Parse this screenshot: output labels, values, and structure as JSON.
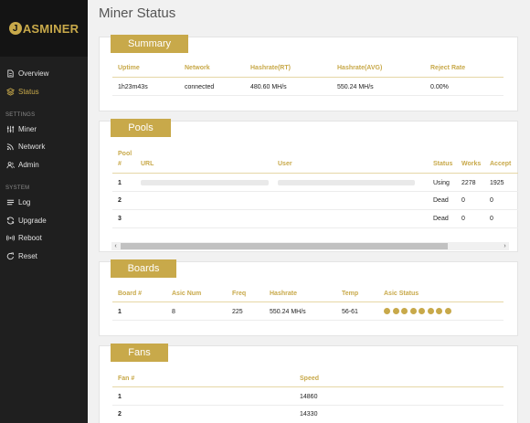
{
  "brand": {
    "logo_mark": "J",
    "logo_text": "ASMINER",
    "accent": "#c8a94a"
  },
  "sidebar": {
    "items_top": [
      {
        "label": "Overview",
        "icon": "file-icon",
        "active": false
      },
      {
        "label": "Status",
        "icon": "layers-icon",
        "active": true
      }
    ],
    "settings_label": "SETTINGS",
    "items_settings": [
      {
        "label": "Miner",
        "icon": "sliders-icon"
      },
      {
        "label": "Network",
        "icon": "rss-icon"
      },
      {
        "label": "Admin",
        "icon": "users-icon"
      }
    ],
    "system_label": "SYSTEM",
    "items_system": [
      {
        "label": "Log",
        "icon": "list-icon"
      },
      {
        "label": "Upgrade",
        "icon": "refresh-icon"
      },
      {
        "label": "Reboot",
        "icon": "broadcast-icon"
      },
      {
        "label": "Reset",
        "icon": "rotate-icon"
      }
    ]
  },
  "page": {
    "title": "Miner Status"
  },
  "summary": {
    "title": "Summary",
    "headers": [
      "Uptime",
      "Network",
      "Hashrate(RT)",
      "Hashrate(AVG)",
      "Reject Rate"
    ],
    "row": [
      "1h23m43s",
      "connected",
      "480.60 MH/s",
      "550.24 MH/s",
      "0.00%"
    ]
  },
  "pools": {
    "title": "Pools",
    "headers": [
      "Pool",
      "#",
      "URL",
      "User",
      "Status",
      "Works",
      "Accept"
    ],
    "rows": [
      {
        "num": "1",
        "status": "Using",
        "works": "2278",
        "accept": "1925"
      },
      {
        "num": "2",
        "status": "Dead",
        "works": "0",
        "accept": "0"
      },
      {
        "num": "3",
        "status": "Dead",
        "works": "0",
        "accept": "0"
      }
    ],
    "scroll_left": "‹",
    "scroll_right": "›"
  },
  "boards": {
    "title": "Boards",
    "headers": [
      "Board #",
      "Asic Num",
      "Freq",
      "Hashrate",
      "Temp",
      "Asic Status"
    ],
    "row": [
      "1",
      "8",
      "225",
      "550.24 MH/s",
      "56-61"
    ],
    "asic_status_count": 8,
    "asic_status_color": "#c8a94a"
  },
  "fans": {
    "title": "Fans",
    "headers": [
      "Fan #",
      "Speed"
    ],
    "rows": [
      [
        "1",
        "14860"
      ],
      [
        "2",
        "14330"
      ]
    ]
  }
}
